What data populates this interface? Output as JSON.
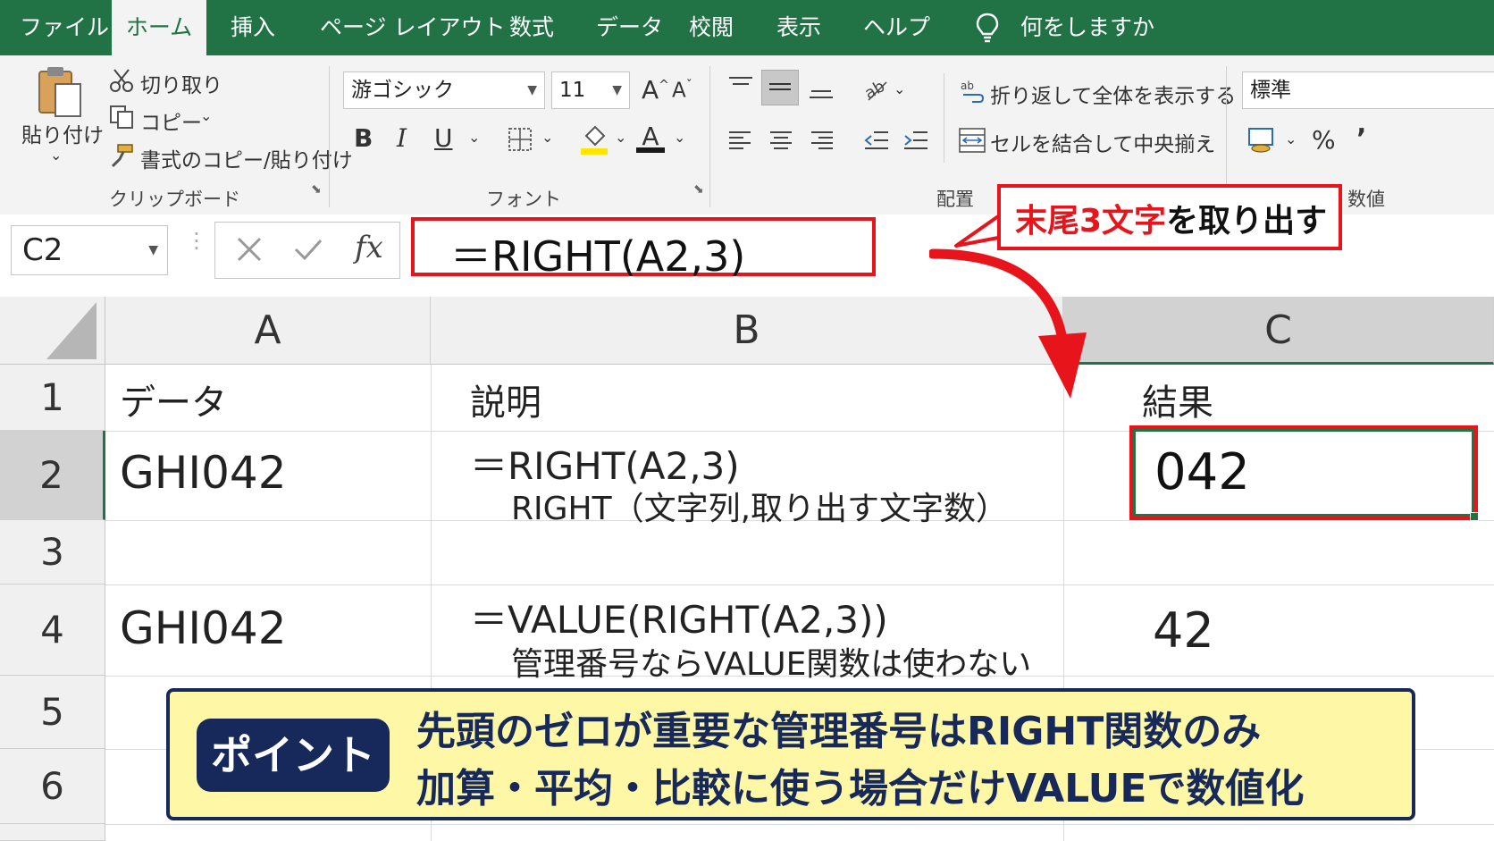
{
  "tabs": [
    "ファイル",
    "ホーム",
    "挿入",
    "ページ レイアウト",
    "数式",
    "データ",
    "校閲",
    "表示",
    "ヘルプ"
  ],
  "tell_me": "何をしますか",
  "ribbon": {
    "clipboard": {
      "paste": "貼り付け",
      "cut": "切り取り",
      "copy": "コピー",
      "format_painter": "書式のコピー/貼り付け",
      "group_label": "クリップボード"
    },
    "font": {
      "font_name": "游ゴシック",
      "font_size": "11",
      "bold": "B",
      "italic": "I",
      "underline": "U",
      "grow": "A",
      "shrink": "A",
      "font_color": "A",
      "group_label": "フォント"
    },
    "alignment": {
      "wrap_text": "折り返して全体を表示する",
      "merge_center": "セルを結合して中央揃え",
      "group_label": "配置"
    },
    "number": {
      "format": "標準",
      "percent": "%",
      "comma": "’",
      "group_label": "数値"
    }
  },
  "formula_bar": {
    "name_box": "C2",
    "fx": "fx",
    "formula": "＝RIGHT(A2,3)"
  },
  "callout": {
    "highlight": "末尾3文字",
    "rest": "を取り出す"
  },
  "columns": [
    "A",
    "B",
    "C"
  ],
  "rows": [
    "1",
    "2",
    "3",
    "4",
    "5",
    "6"
  ],
  "cells": {
    "A1": "データ",
    "B1": "説明",
    "C1": "結果",
    "A2": "GHI042",
    "B2_line1": "＝RIGHT(A2,3)",
    "B2_line2": "RIGHT（文字列,取り出す文字数）",
    "C2": "042",
    "A4": "GHI042",
    "B4_line1": "＝VALUE(RIGHT(A2,3))",
    "B4_line2": "管理番号ならVALUE関数は使わない",
    "C4": "42"
  },
  "point_box": {
    "badge": "ポイント",
    "line1": "先頭のゼロが重要な管理番号はRIGHT関数のみ",
    "line2": "加算・平均・比較に使う場合だけVALUEで数値化"
  },
  "colors": {
    "excel_green": "#217346",
    "red_accent": "#e8141c",
    "point_bg": "#fdf7a6",
    "badge_bg": "#16295a"
  }
}
